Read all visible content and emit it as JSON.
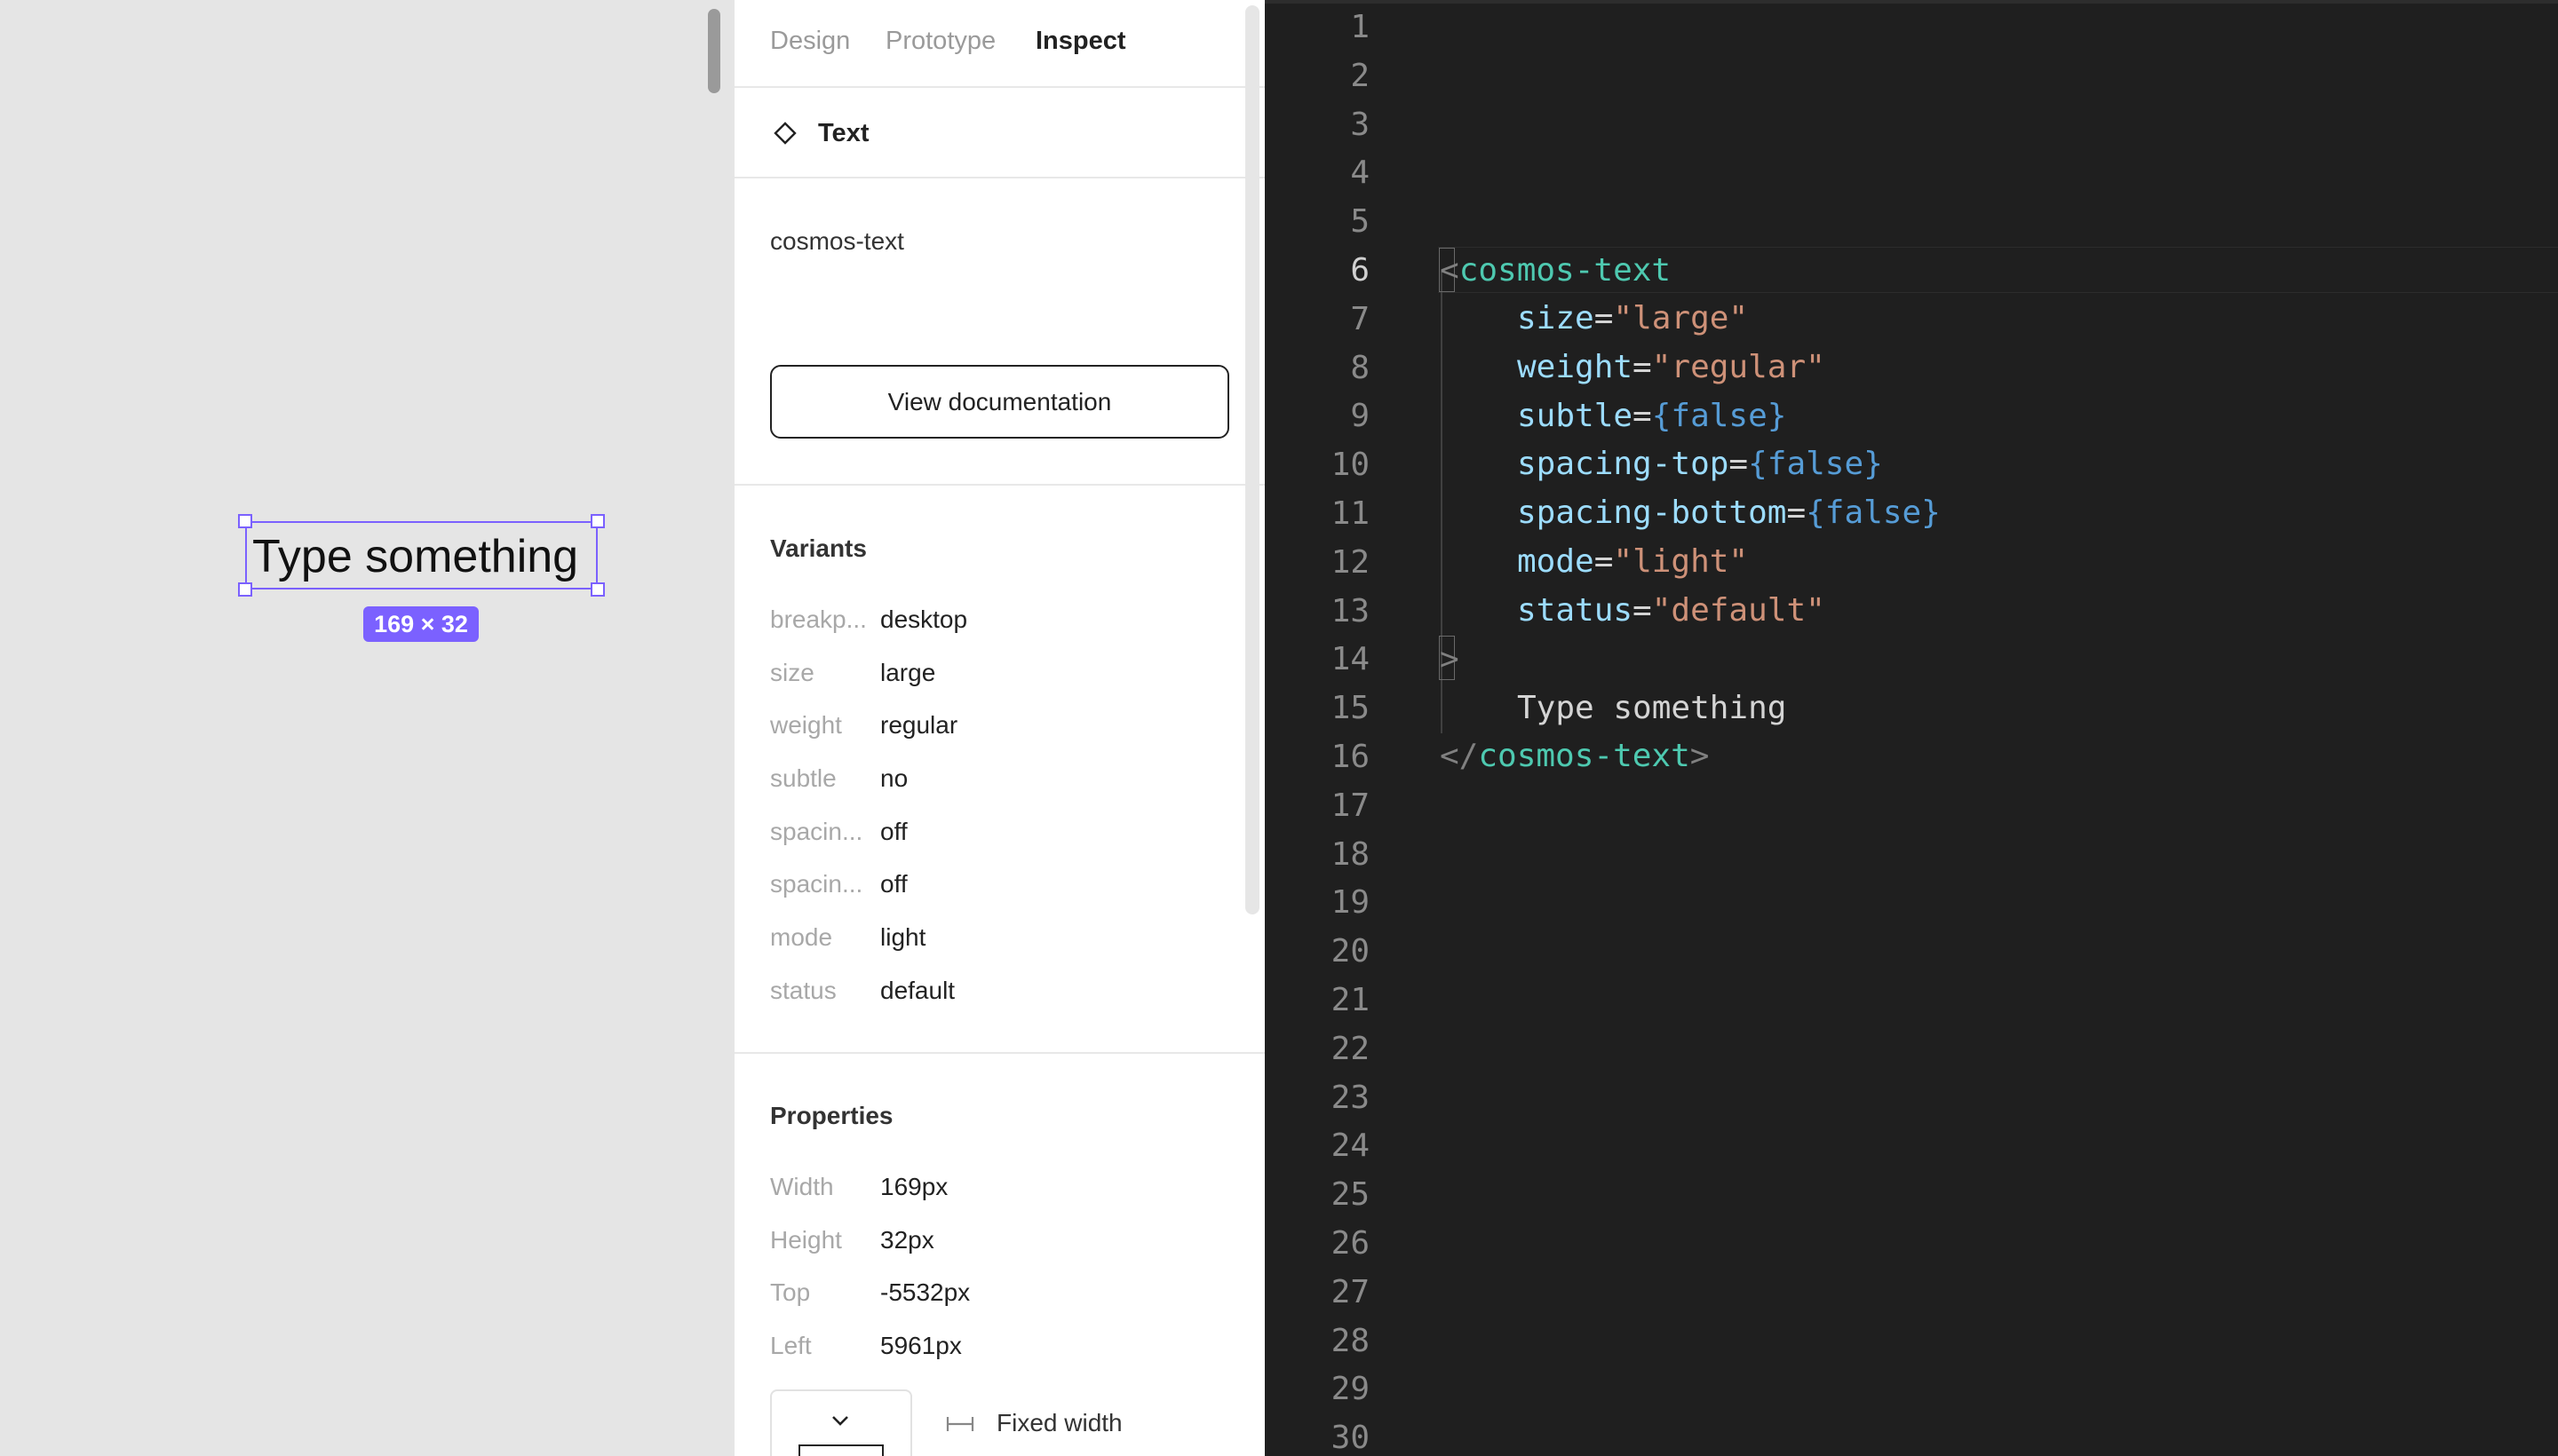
{
  "canvas": {
    "selected_text": "Type something",
    "size_badge": "169 × 32"
  },
  "panel": {
    "tabs": [
      "Design",
      "Prototype",
      "Inspect"
    ],
    "active_tab": "Inspect",
    "selection_type": "Text",
    "component_name": "cosmos-text",
    "view_doc_label": "View documentation",
    "variants_title": "Variants",
    "variants": [
      {
        "label": "breakp...",
        "value": "desktop"
      },
      {
        "label": "size",
        "value": "large"
      },
      {
        "label": "weight",
        "value": "regular"
      },
      {
        "label": "subtle",
        "value": "no"
      },
      {
        "label": "spacin...",
        "value": "off"
      },
      {
        "label": "spacin...",
        "value": "off"
      },
      {
        "label": "mode",
        "value": "light"
      },
      {
        "label": "status",
        "value": "default"
      }
    ],
    "properties_title": "Properties",
    "properties": [
      {
        "label": "Width",
        "value": "169px"
      },
      {
        "label": "Height",
        "value": "32px"
      },
      {
        "label": "Top",
        "value": "-5532px"
      },
      {
        "label": "Left",
        "value": "5961px"
      }
    ],
    "resize_label": "Fixed width",
    "icons": [
      "component-diamond-icon",
      "chevron-down-icon",
      "fixed-width-icon"
    ]
  },
  "code": {
    "line_numbers": [
      "1",
      "2",
      "3",
      "4",
      "5",
      "6",
      "7",
      "8",
      "9",
      "10",
      "11",
      "12",
      "13",
      "14",
      "15",
      "16",
      "17",
      "18",
      "19",
      "20",
      "21",
      "22",
      "23",
      "24",
      "25",
      "26",
      "27",
      "28",
      "29",
      "30"
    ],
    "active_line": "6",
    "open_lt": "<",
    "tag_name": "cosmos-text",
    "close_gt": ">",
    "attributes": [
      {
        "name": "size",
        "eq": "=",
        "value": "\"large\"",
        "kind": "str"
      },
      {
        "name": "weight",
        "eq": "=",
        "value": "\"regular\"",
        "kind": "str"
      },
      {
        "name": "subtle",
        "eq": "=",
        "value": "{false}",
        "kind": "kw"
      },
      {
        "name": "spacing-top",
        "eq": "=",
        "value": "{false}",
        "kind": "kw"
      },
      {
        "name": "spacing-bottom",
        "eq": "=",
        "value": "{false}",
        "kind": "kw"
      },
      {
        "name": "mode",
        "eq": "=",
        "value": "\"light\"",
        "kind": "str"
      },
      {
        "name": "status",
        "eq": "=",
        "value": "\"default\"",
        "kind": "str"
      }
    ],
    "content": "Type something",
    "closing_open": "</",
    "closing_tag": "cosmos-text",
    "closing_gt": ">"
  },
  "colors": {
    "selection": "#7b61ff",
    "code_bg": "#1f1f1f",
    "tag": "#4ec9b0",
    "attr": "#9cdcfe",
    "string": "#ce9178",
    "keyword": "#569cd6"
  }
}
